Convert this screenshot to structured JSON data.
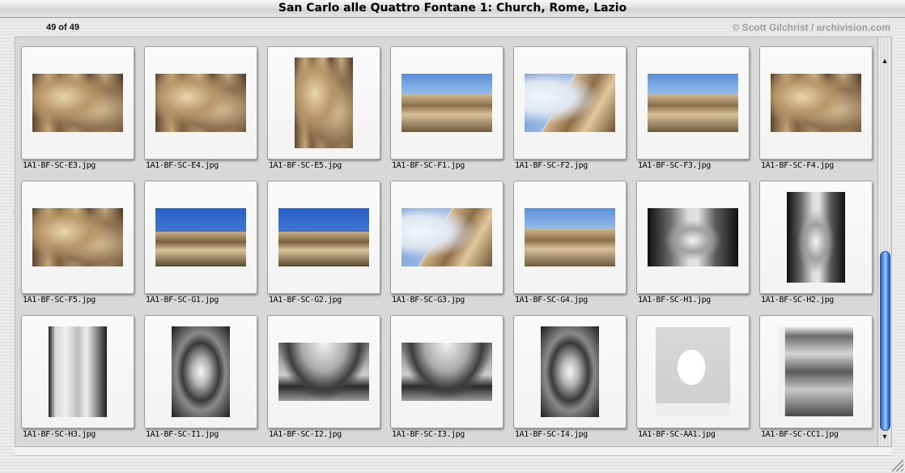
{
  "window": {
    "title": "San Carlo alle Quattro Fontane 1: Church, Rome, Lazio"
  },
  "header": {
    "counter": "49 of 49",
    "credit": "© Scott Gilchrist / archivision.com"
  },
  "scrollbar": {
    "up_icon": "arrow-up-icon",
    "down_icon": "arrow-down-icon",
    "up_glyph": "▲",
    "down_glyph": "▼",
    "position": 1.0
  },
  "thumbnails": [
    {
      "filename": "1A1-BF-SC-E3.jpg",
      "style": "t-stone",
      "orientation": "landscape"
    },
    {
      "filename": "1A1-BF-SC-E4.jpg",
      "style": "t-stone",
      "orientation": "landscape"
    },
    {
      "filename": "1A1-BF-SC-E5.jpg",
      "style": "t-stone",
      "orientation": "portrait"
    },
    {
      "filename": "1A1-BF-SC-F1.jpg",
      "style": "t-sky",
      "orientation": "landscape"
    },
    {
      "filename": "1A1-BF-SC-F2.jpg",
      "style": "t-cloud",
      "orientation": "landscape"
    },
    {
      "filename": "1A1-BF-SC-F3.jpg",
      "style": "t-sky",
      "orientation": "landscape"
    },
    {
      "filename": "1A1-BF-SC-F4.jpg",
      "style": "t-stone",
      "orientation": "landscape"
    },
    {
      "filename": "1A1-BF-SC-F5.jpg",
      "style": "t-stone",
      "orientation": "landscape"
    },
    {
      "filename": "1A1-BF-SC-G1.jpg",
      "style": "t-skyblue",
      "orientation": "landscape"
    },
    {
      "filename": "1A1-BF-SC-G2.jpg",
      "style": "t-skyblue",
      "orientation": "landscape"
    },
    {
      "filename": "1A1-BF-SC-G3.jpg",
      "style": "t-cloud",
      "orientation": "landscape"
    },
    {
      "filename": "1A1-BF-SC-G4.jpg",
      "style": "t-sky",
      "orientation": "landscape"
    },
    {
      "filename": "1A1-BF-SC-H1.jpg",
      "style": "t-interior",
      "orientation": "landscape"
    },
    {
      "filename": "1A1-BF-SC-H2.jpg",
      "style": "t-interior",
      "orientation": "portrait"
    },
    {
      "filename": "1A1-BF-SC-H3.jpg",
      "style": "t-door",
      "orientation": "portrait"
    },
    {
      "filename": "1A1-BF-SC-I1.jpg",
      "style": "t-bwdome",
      "orientation": "portrait"
    },
    {
      "filename": "1A1-BF-SC-I2.jpg",
      "style": "t-bwcurve",
      "orientation": "landscape"
    },
    {
      "filename": "1A1-BF-SC-I3.jpg",
      "style": "t-bwcurve",
      "orientation": "landscape"
    },
    {
      "filename": "1A1-BF-SC-I4.jpg",
      "style": "t-bwdome",
      "orientation": "portrait"
    },
    {
      "filename": "1A1-BF-SC-AA1.jpg",
      "style": "t-plan",
      "orientation": "portrait-wide"
    },
    {
      "filename": "1A1-BF-SC-CC1.jpg",
      "style": "t-facade",
      "orientation": "portrait-wide"
    }
  ]
}
